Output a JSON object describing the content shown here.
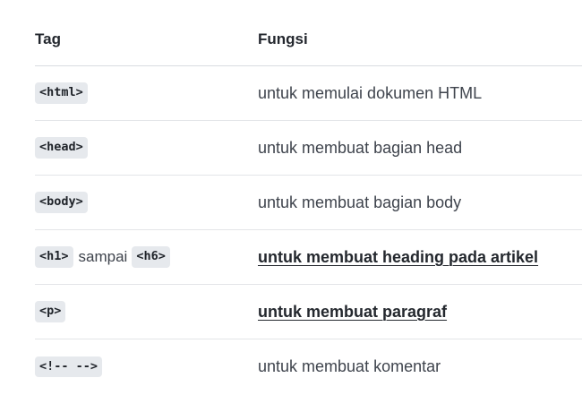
{
  "table": {
    "headers": {
      "tag": "Tag",
      "fungsi": "Fungsi"
    },
    "rows": [
      {
        "tag": "<html>",
        "fungsi": "untuk memulai dokumen HTML"
      },
      {
        "tag": "<head>",
        "fungsi": "untuk membuat bagian head"
      },
      {
        "tag": "<body>",
        "fungsi": "untuk membuat bagian body"
      },
      {
        "tag": "<h1>",
        "between": "sampai",
        "tag2": "<h6>",
        "fungsi": "untuk membuat heading pada artikel"
      },
      {
        "tag": "<p>",
        "fungsi": "untuk membuat paragraf"
      },
      {
        "tag": "<!-- -->",
        "fungsi": "untuk membuat komentar"
      }
    ]
  }
}
